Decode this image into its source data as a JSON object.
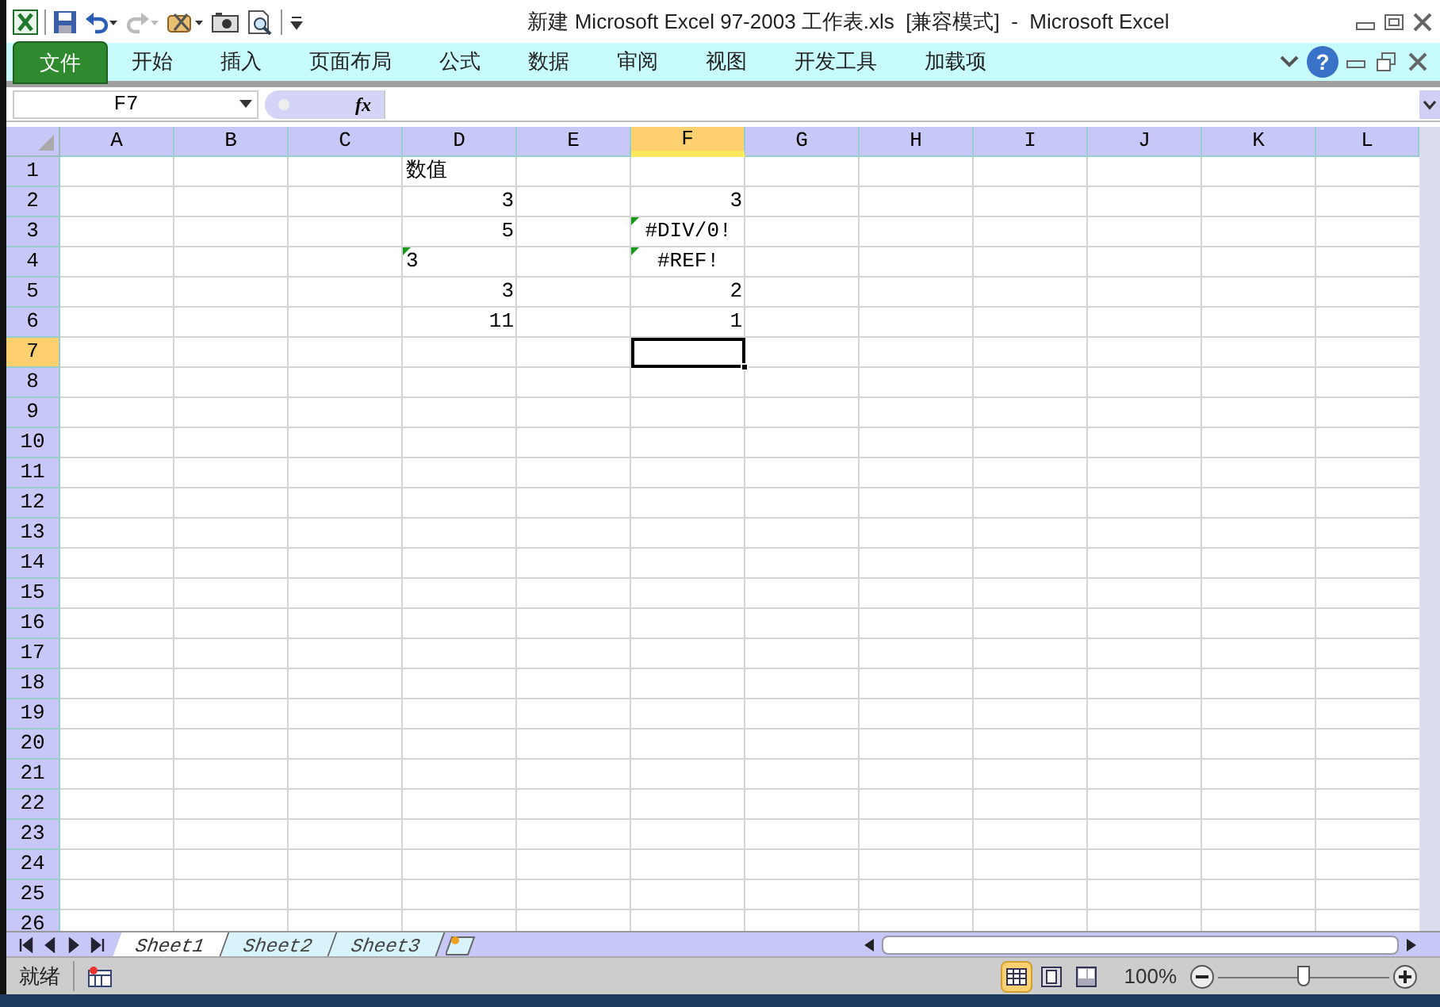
{
  "window": {
    "title": "新建 Microsoft Excel 97-2003 工作表.xls  [兼容模式]  -  Microsoft Excel"
  },
  "ribbon_tabs": [
    {
      "label": "文件",
      "kind": "file"
    },
    {
      "label": "开始",
      "kind": "tab"
    },
    {
      "label": "插入",
      "kind": "tab"
    },
    {
      "label": "页面布局",
      "kind": "tab"
    },
    {
      "label": "公式",
      "kind": "tab"
    },
    {
      "label": "数据",
      "kind": "tab"
    },
    {
      "label": "审阅",
      "kind": "tab"
    },
    {
      "label": "视图",
      "kind": "tab"
    },
    {
      "label": "开发工具",
      "kind": "tab"
    },
    {
      "label": "加载项",
      "kind": "tab"
    }
  ],
  "help_button": {
    "label": "?"
  },
  "formula_bar": {
    "name_box": "F7",
    "function_button": "fx"
  },
  "sheet": {
    "columns": [
      {
        "label": "A",
        "selected": false
      },
      {
        "label": "B",
        "selected": false
      },
      {
        "label": "C",
        "selected": false
      },
      {
        "label": "D",
        "selected": false
      },
      {
        "label": "E",
        "selected": false
      },
      {
        "label": "F",
        "selected": true
      },
      {
        "label": "G",
        "selected": false
      },
      {
        "label": "H",
        "selected": false
      },
      {
        "label": "I",
        "selected": false
      },
      {
        "label": "J",
        "selected": false
      },
      {
        "label": "K",
        "selected": false
      },
      {
        "label": "L",
        "selected": false
      }
    ],
    "rows": [
      {
        "label": "1",
        "selected": false,
        "cells": [
          {},
          {},
          {},
          {
            "text": "数值",
            "kind": "text",
            "flag": false
          }
        ]
      },
      {
        "label": "2",
        "selected": false,
        "cells": [
          {},
          {},
          {},
          {
            "text": "3",
            "kind": "number",
            "flag": false
          },
          {},
          {
            "text": "3",
            "kind": "number",
            "flag": false
          }
        ]
      },
      {
        "label": "3",
        "selected": false,
        "cells": [
          {},
          {},
          {},
          {
            "text": "5",
            "kind": "number",
            "flag": false
          },
          {},
          {
            "text": "#DIV/0!",
            "kind": "error",
            "flag": true
          }
        ]
      },
      {
        "label": "4",
        "selected": false,
        "cells": [
          {},
          {},
          {},
          {
            "text": "3",
            "kind": "text",
            "flag": true
          },
          {},
          {
            "text": "#REF!",
            "kind": "error",
            "flag": true
          }
        ]
      },
      {
        "label": "5",
        "selected": false,
        "cells": [
          {},
          {},
          {},
          {
            "text": "3",
            "kind": "number",
            "flag": false
          },
          {},
          {
            "text": "2",
            "kind": "number",
            "flag": false
          }
        ]
      },
      {
        "label": "6",
        "selected": false,
        "cells": [
          {},
          {},
          {},
          {
            "text": "11",
            "kind": "number",
            "flag": false
          },
          {},
          {
            "text": "1",
            "kind": "number",
            "flag": false
          }
        ]
      },
      {
        "label": "7",
        "selected": true
      },
      {
        "label": "8",
        "selected": false
      },
      {
        "label": "9",
        "selected": false
      },
      {
        "label": "10",
        "selected": false
      },
      {
        "label": "11",
        "selected": false
      },
      {
        "label": "12",
        "selected": false
      },
      {
        "label": "13",
        "selected": false
      },
      {
        "label": "14",
        "selected": false
      },
      {
        "label": "15",
        "selected": false
      },
      {
        "label": "16",
        "selected": false
      },
      {
        "label": "17",
        "selected": false
      },
      {
        "label": "18",
        "selected": false
      },
      {
        "label": "19",
        "selected": false
      },
      {
        "label": "20",
        "selected": false
      },
      {
        "label": "21",
        "selected": false
      },
      {
        "label": "22",
        "selected": false
      },
      {
        "label": "23",
        "selected": false
      },
      {
        "label": "24",
        "selected": false
      },
      {
        "label": "25",
        "selected": false
      },
      {
        "label": "26",
        "selected": false
      }
    ]
  },
  "sheet_tabs": [
    {
      "label": "Sheet1",
      "selected": true
    },
    {
      "label": "Sheet2",
      "selected": false
    },
    {
      "label": "Sheet3",
      "selected": false
    }
  ],
  "status_bar": {
    "status": "就绪",
    "views": [
      {
        "kind": "normal",
        "selected": true
      },
      {
        "kind": "page_layout",
        "selected": false
      },
      {
        "kind": "page_break",
        "selected": false
      }
    ],
    "zoom": "100%",
    "zoom_slider": {
      "level": 0.5
    }
  }
}
